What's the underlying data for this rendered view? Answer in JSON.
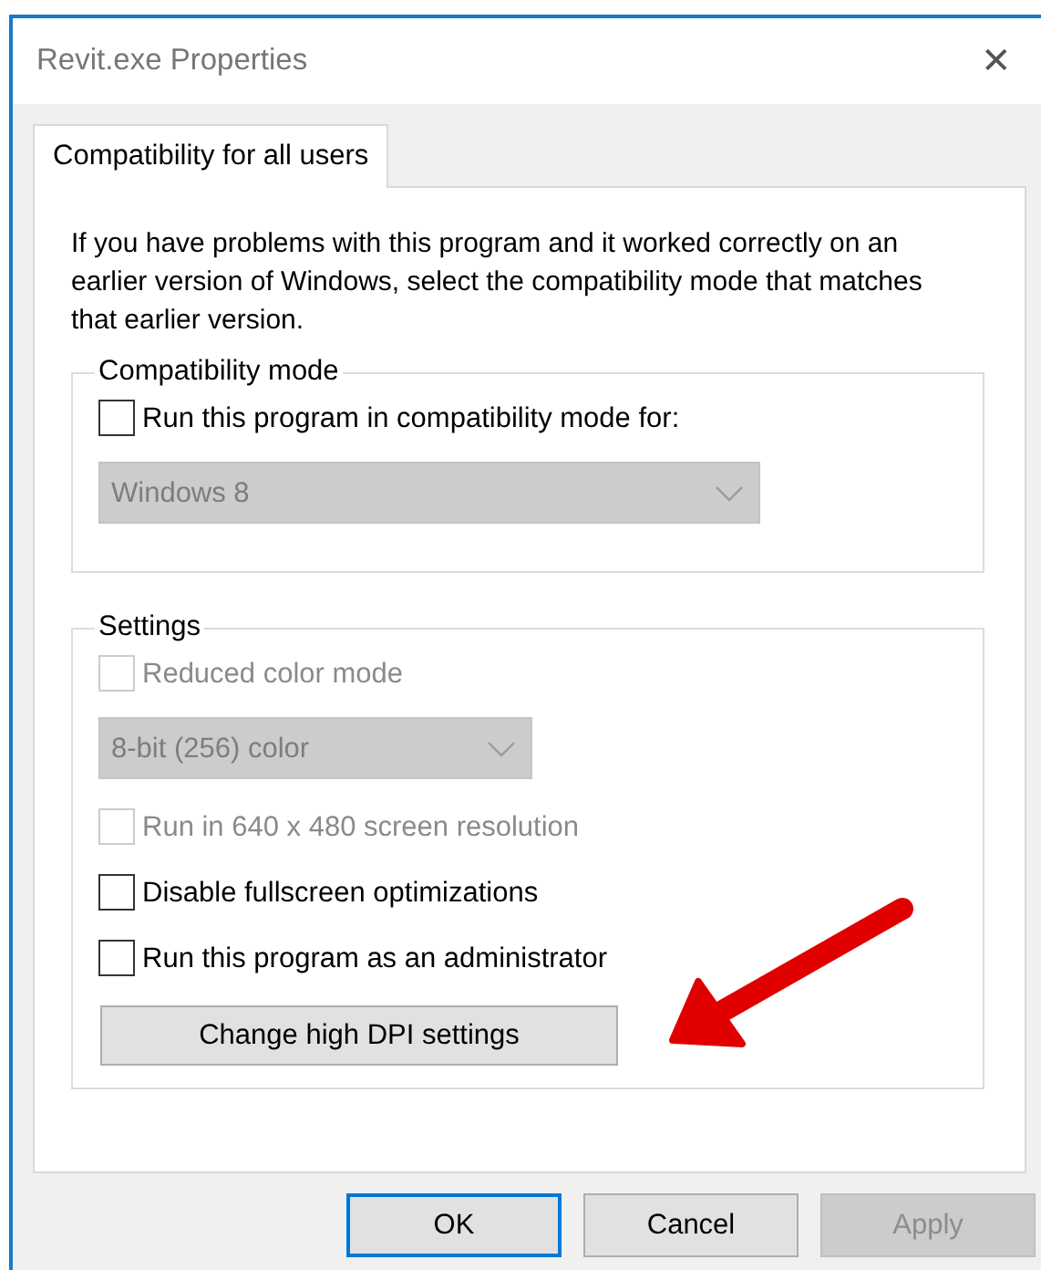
{
  "window": {
    "title": "Revit.exe Properties",
    "close": "✕"
  },
  "tabs": [
    {
      "label": "Compatibility for all users",
      "selected": true
    }
  ],
  "description": "If you have problems with this program and it worked correctly on an earlier version of Windows, select the compatibility mode that matches that earlier version.",
  "groups": [
    {
      "title": "Compatibility mode",
      "items": [
        {
          "kind": "checkbox",
          "label": "Run this program in compatibility mode for:",
          "checked": false,
          "disabled": false
        },
        {
          "kind": "select",
          "value": "Windows 8",
          "disabled": true
        }
      ]
    },
    {
      "title": "Settings",
      "items": [
        {
          "kind": "checkbox",
          "label": "Reduced color mode",
          "checked": false,
          "disabled": true
        },
        {
          "kind": "select",
          "value": "8-bit (256) color",
          "disabled": true
        },
        {
          "kind": "checkbox",
          "label": "Run in 640 x 480 screen resolution",
          "checked": false,
          "disabled": true
        },
        {
          "kind": "checkbox",
          "label": "Disable fullscreen optimizations",
          "checked": false,
          "disabled": false
        },
        {
          "kind": "checkbox",
          "label": "Run this program as an administrator",
          "checked": false,
          "disabled": false
        },
        {
          "kind": "button",
          "label": "Change high DPI settings",
          "disabled": false
        }
      ]
    }
  ],
  "buttons": [
    {
      "label": "OK",
      "default": true,
      "disabled": false
    },
    {
      "label": "Cancel",
      "default": false,
      "disabled": false
    },
    {
      "label": "Apply",
      "default": false,
      "disabled": true
    }
  ]
}
